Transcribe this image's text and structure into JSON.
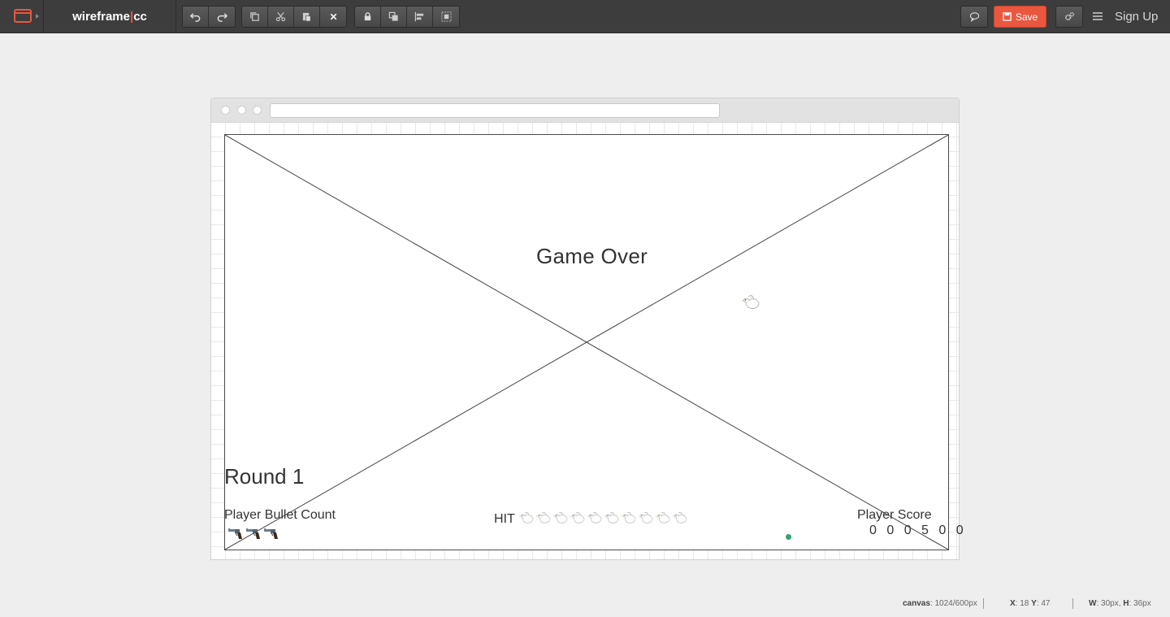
{
  "app": {
    "brand_left": "wireframe",
    "brand_sep": "|",
    "brand_right": "cc"
  },
  "toolbar": {
    "history": [
      "undo-icon",
      "redo-icon"
    ],
    "edit": [
      "copy-icon",
      "cut-icon",
      "paste-icon",
      "delete-icon"
    ],
    "arrange": [
      "lock-icon",
      "arrange-icon",
      "align-icon",
      "group-icon"
    ],
    "comment_icon": "comment-icon",
    "save_label": "Save",
    "settings_icon": "settings-icon",
    "menu_icon": "menu-icon",
    "signup_label": "Sign Up"
  },
  "game": {
    "title": "Game Over",
    "round": "Round 1",
    "bullet_label": "Player Bullet Count",
    "bullet_count": 3,
    "hit_label": "HIT",
    "hit_ducks": 10,
    "score_label": "Player Score",
    "score_value": "0 0 0 5 0 0"
  },
  "status": {
    "canvas_label": "canvas",
    "canvas_value": ": 1024/600px",
    "x_label": "X",
    "x_value": ": 18",
    "y_label": "Y",
    "y_value": ": 47",
    "w_label": "W",
    "w_value": ": 30px,",
    "h_label": "H",
    "h_value": ": 36px"
  },
  "colors": {
    "accent": "#e9573f",
    "toolbar_bg": "#3d3d3d",
    "canvas_bg": "#eeeeee",
    "indicator": "#2fa66b"
  }
}
